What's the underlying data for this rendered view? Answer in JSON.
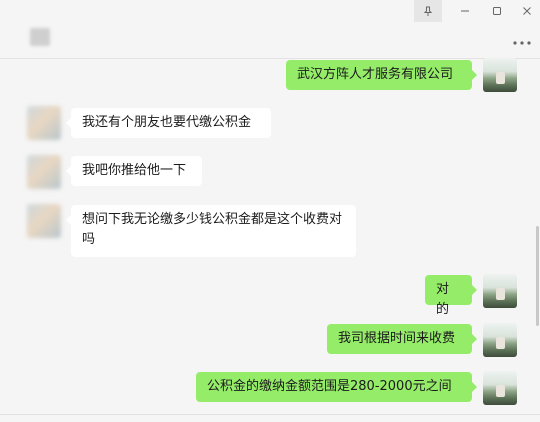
{
  "window": {
    "title": "",
    "controls": {
      "pin_icon": "pin-icon",
      "minimize_icon": "minimize-icon",
      "maximize_icon": "maximize-icon",
      "close_icon": "close-icon",
      "more_icon": "more-icon"
    }
  },
  "messages": [
    {
      "side": "right",
      "text": "武汉方阵人才服务有限公司"
    },
    {
      "side": "left",
      "text": "我还有个朋友也要代缴公积金"
    },
    {
      "side": "left",
      "text": "我吧你推给他一下"
    },
    {
      "side": "left",
      "text": "想问下我无论缴多少钱公积金都是这个收费对吗"
    },
    {
      "side": "right",
      "text": "对的"
    },
    {
      "side": "right",
      "text": "我司根据时间来收费"
    },
    {
      "side": "right",
      "text": "公积金的缴纳金额范围是280-2000元之间"
    }
  ],
  "colors": {
    "background": "#f5f5f5",
    "incoming_bubble": "#ffffff",
    "outgoing_bubble": "#95ec69"
  }
}
